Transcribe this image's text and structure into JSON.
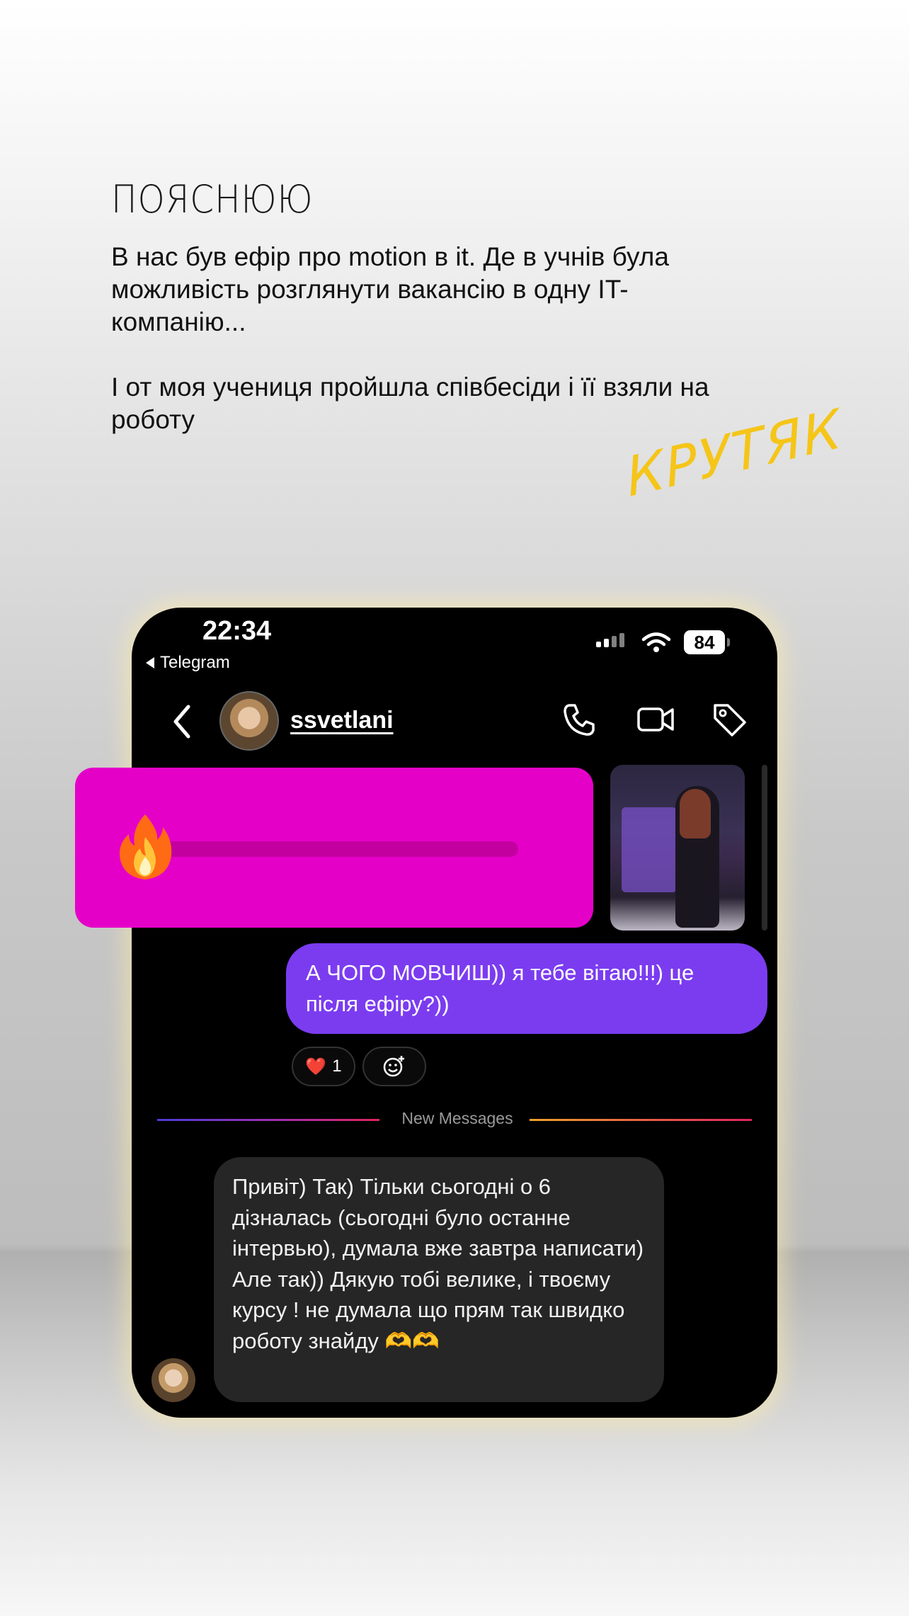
{
  "page": {
    "heading": "ПОЯСНЮЮ",
    "intro_line1": "В нас був ефір про motion в it. Де в учнів була можливість розглянути вакансію в одну IT-компанію...",
    "intro_line2": "І от моя учениця пройшла співбесіди і її взяли на роботу",
    "accent_word": "КРУТЯК",
    "accent_color": "#f5c518"
  },
  "status_bar": {
    "time": "22:34",
    "back_app": "Telegram",
    "battery": "84"
  },
  "chat_header": {
    "username": "ssvetlani"
  },
  "messages": {
    "sent_text": "А ЧОГО МОВЧИШ)) я тебе вітаю!!!) це після ефіру?))",
    "reaction_emoji": "❤️",
    "reaction_count": "1",
    "divider_label": "New Messages",
    "received_text": "Привіт) Так) Тільки сьогодні о 6 дізналась (сьогодні було останне інтервью), думала вже завтра написати) Але так)) Дякую тобі велике, і твоєму курсу ! не думала що прям так швидко роботу знайду 🫶🫶"
  },
  "overlay": {
    "slider_emoji": "🔥",
    "slider_level": 0.0,
    "card_color": "#e500c8"
  },
  "colors": {
    "sent_bubble": "#7b3cf0",
    "received_bubble": "#262626"
  }
}
